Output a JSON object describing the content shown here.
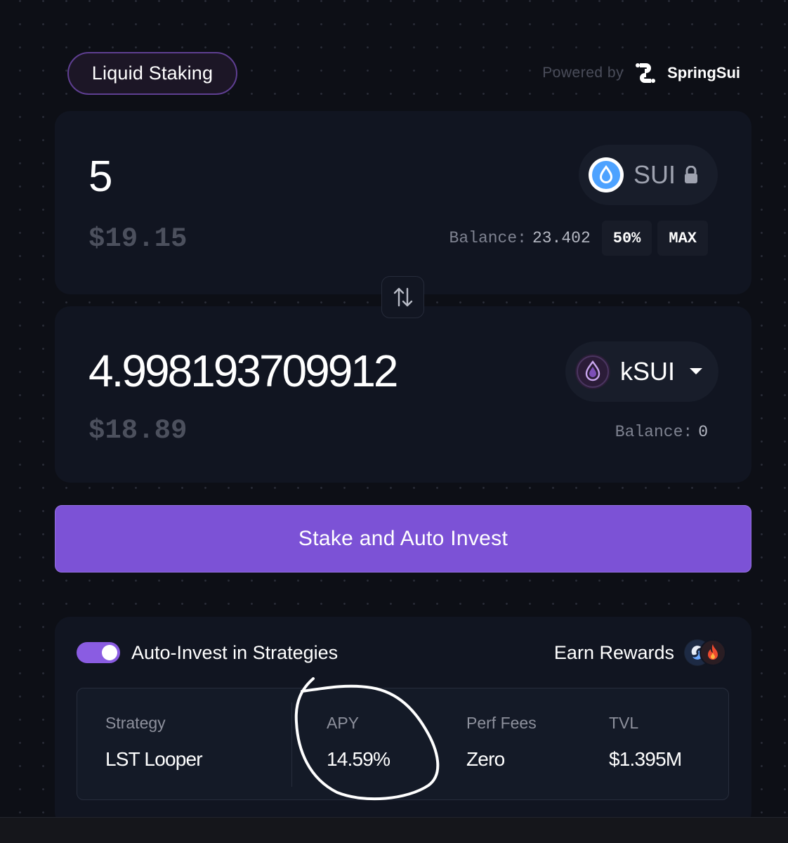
{
  "header": {
    "tab_label": "Liquid Staking",
    "powered_by": "Powered by",
    "brand": "SpringSui"
  },
  "from": {
    "amount": "5",
    "usd_value": "$19.15",
    "token": "SUI",
    "token_icon": "sui-drop-icon",
    "balance_label": "Balance:",
    "balance_value": "23.402",
    "half_label": "50%",
    "max_label": "MAX"
  },
  "swap_icon": "swap-arrows-icon",
  "to": {
    "amount": "4.998193709912",
    "usd_value": "$18.89",
    "token": "kSUI",
    "token_icon": "ksui-icon",
    "balance_label": "Balance:",
    "balance_value": "0"
  },
  "action": {
    "stake_label": "Stake and Auto Invest"
  },
  "strategies": {
    "toggle_label": "Auto-Invest in Strategies",
    "toggle_on": true,
    "earn_label": "Earn Rewards",
    "columns": [
      {
        "head": "Strategy",
        "value": "LST Looper"
      },
      {
        "head": "APY",
        "value": "14.59%"
      },
      {
        "head": "Perf Fees",
        "value": "Zero"
      },
      {
        "head": "TVL",
        "value": "$1.395M"
      }
    ]
  },
  "colors": {
    "accent": "#7c52d6",
    "background": "#0d0f16",
    "card": "#111521"
  }
}
